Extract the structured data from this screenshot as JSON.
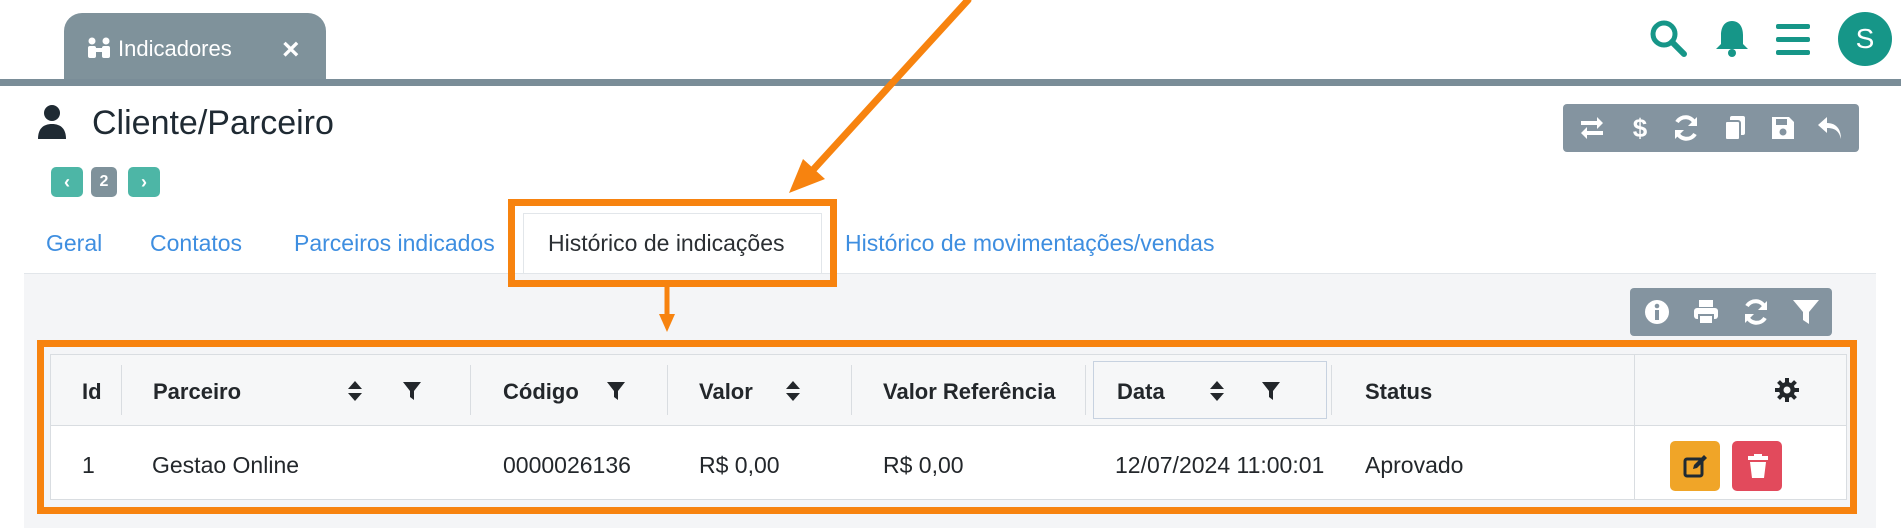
{
  "app_tab": {
    "label": "Indicadores",
    "close": "×",
    "icon": "handshake-icon"
  },
  "top_icons": [
    "search-icon",
    "bell-icon",
    "menu-icon"
  ],
  "user": {
    "avatar_initial": "S"
  },
  "header": {
    "title": "Cliente/Parceiro",
    "title_icon": "user-icon",
    "pager": {
      "prev": "‹",
      "page": "2",
      "next": "›"
    }
  },
  "header_toolbar": [
    "retweet-icon",
    "dollar-icon",
    "refresh-icon",
    "copy-icon",
    "save-icon",
    "undo-icon"
  ],
  "tabs": [
    {
      "label": "Geral"
    },
    {
      "label": "Contatos"
    },
    {
      "label": "Parceiros indicados"
    },
    {
      "label": "Histórico de indicações",
      "active": true
    },
    {
      "label": "Histórico de movimentações/vendas"
    }
  ],
  "table_toolbar": [
    "info-icon",
    "print-icon",
    "refresh-icon",
    "filter-icon"
  ],
  "table": {
    "columns": [
      "Id",
      "Parceiro",
      "Código",
      "Valor",
      "Valor Referência",
      "Data",
      "Status"
    ],
    "rows": [
      {
        "id": "1",
        "parceiro": "Gestao Online",
        "codigo": "0000026136",
        "valor": "R$ 0,00",
        "valor_referencia": "R$ 0,00",
        "data": "12/07/2024 11:00:01",
        "status": "Aprovado"
      }
    ]
  },
  "colors": {
    "accent": "#169688",
    "tab_link": "#3e8ee0",
    "toolbar_bg": "#8494a0",
    "annotation": "#f7830f",
    "edit_button": "#f0a528",
    "delete_button": "#e24a5c"
  }
}
